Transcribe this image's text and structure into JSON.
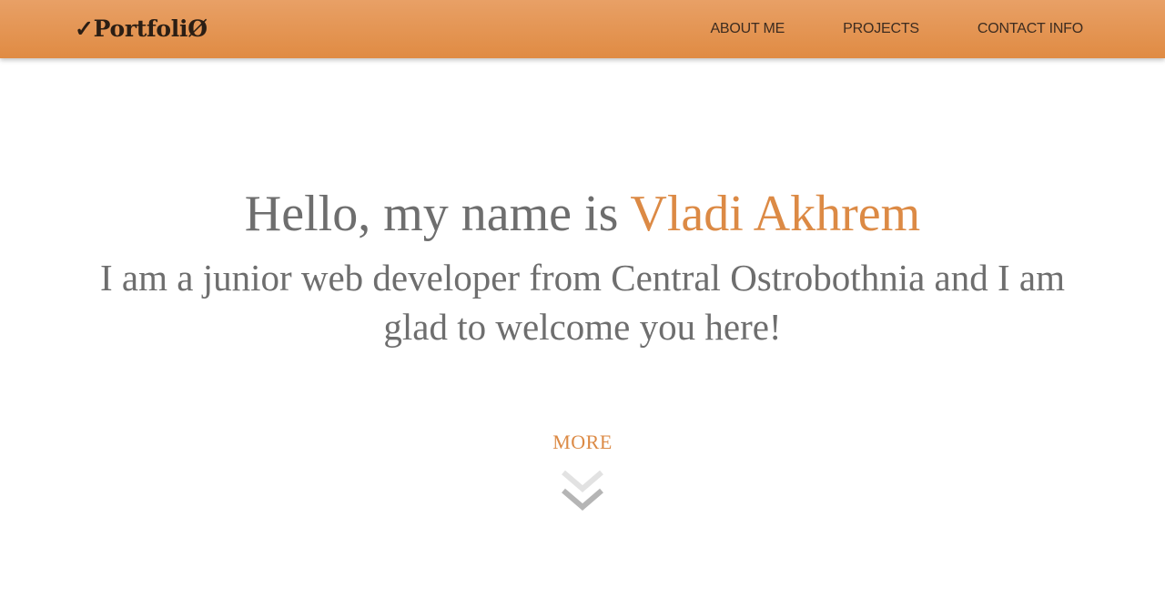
{
  "header": {
    "logo": "✓PortfoliØ",
    "nav": [
      {
        "label": "ABOUT ME"
      },
      {
        "label": "PROJECTS"
      },
      {
        "label": "CONTACT INFO"
      }
    ]
  },
  "hero": {
    "greeting_prefix": "Hello, my name is ",
    "name": "Vladi Akhrem",
    "tagline": "I am a junior web developer from Central Ostrobothnia and I am glad to welcome you here!",
    "more_label": "MORE",
    "more_icon": "double-chevron-down-icon"
  },
  "colors": {
    "header_gradient_top": "#e8a066",
    "header_gradient_bottom": "#e08b43",
    "accent": "#dc8a45",
    "text_gray": "#6e6e6e",
    "chevron_light": "#e0e0e0",
    "chevron_dark": "#b5b5b5"
  }
}
